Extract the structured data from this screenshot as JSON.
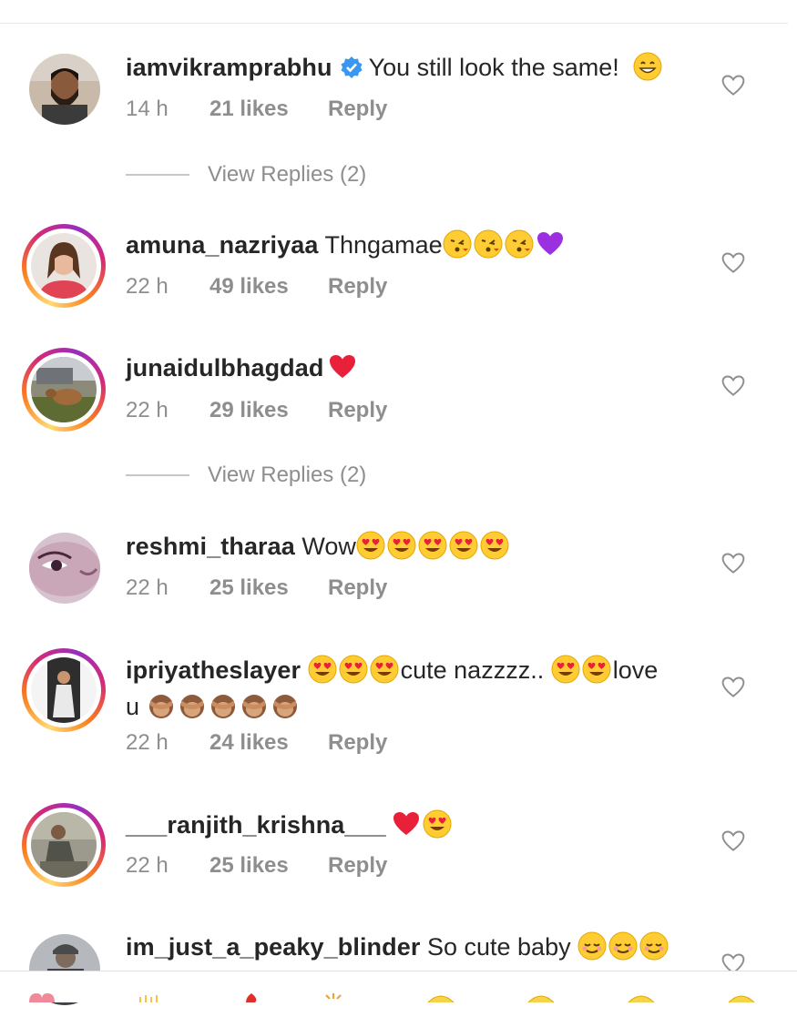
{
  "comments": [
    {
      "username": "iamvikramprabhu",
      "verified": true,
      "text": "You still look the same!",
      "emojis": [
        "grin"
      ],
      "time": "14 h",
      "likes": "21 likes",
      "reply": "Reply",
      "view_replies": "View Replies (2)"
    },
    {
      "username": "amuna_nazriyaa",
      "text": "Thngamae",
      "emojis": [
        "kiss",
        "kiss",
        "kiss",
        "purple-heart"
      ],
      "time": "22 h",
      "likes": "49 likes",
      "reply": "Reply"
    },
    {
      "username": "junaidulbhagdad",
      "text": "",
      "emojis": [
        "red-heart"
      ],
      "time": "22 h",
      "likes": "29 likes",
      "reply": "Reply",
      "view_replies": "View Replies (2)"
    },
    {
      "username": "reshmi_tharaa",
      "text": "Wow",
      "emojis": [
        "heart-eyes",
        "heart-eyes",
        "heart-eyes",
        "heart-eyes",
        "heart-eyes"
      ],
      "time": "22 h",
      "likes": "25 likes",
      "reply": "Reply"
    },
    {
      "username": "ipriyatheslayer",
      "text_a": "cute nazzzz..",
      "text_b": "love",
      "text_c": "u",
      "time": "22 h",
      "likes": "24 likes",
      "reply": "Reply"
    },
    {
      "username": "___ranjith_krishna___",
      "text": "",
      "emojis": [
        "red-heart",
        "heart-eyes"
      ],
      "time": "22 h",
      "likes": "25 likes",
      "reply": "Reply"
    },
    {
      "username": "im_just_a_peaky_blinder",
      "text": "So cute baby",
      "emojis": [
        "relieved",
        "relieved",
        "relieved"
      ]
    }
  ],
  "icons": {
    "like": "heart-outline-icon",
    "verified": "verified-badge-icon"
  },
  "colors": {
    "username": "#262626",
    "meta": "#8e8e8e",
    "verified": "#3897f0",
    "story_ring": "#d62976"
  }
}
